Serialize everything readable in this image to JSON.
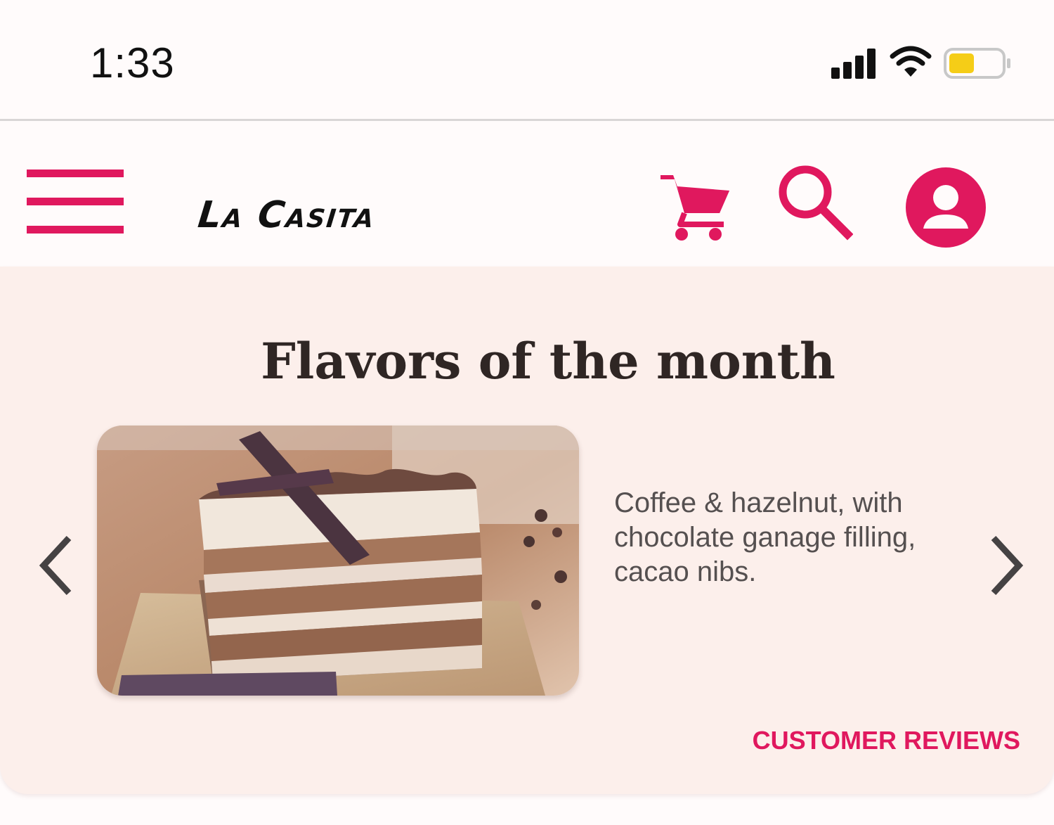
{
  "status_bar": {
    "time": "1:33",
    "icons": [
      "signal-icon",
      "wifi-icon",
      "battery-icon"
    ],
    "battery_color": "#f5cd17"
  },
  "header": {
    "brand": "La Casita",
    "icons": [
      "menu-icon",
      "cart-icon",
      "search-icon",
      "account-icon"
    ],
    "accent_color": "#e0185e"
  },
  "feature": {
    "title": "Flavors of the month",
    "image": "layered-coffee-cake-photo",
    "description": "Coffee & hazelnut, with chocolate ganage filling, cacao nibs.",
    "reviews_label": "CUSTOMER REVIEWS",
    "nav_icons": [
      "chevron-left-icon",
      "chevron-right-icon"
    ],
    "background_color": "#fcefeb"
  }
}
